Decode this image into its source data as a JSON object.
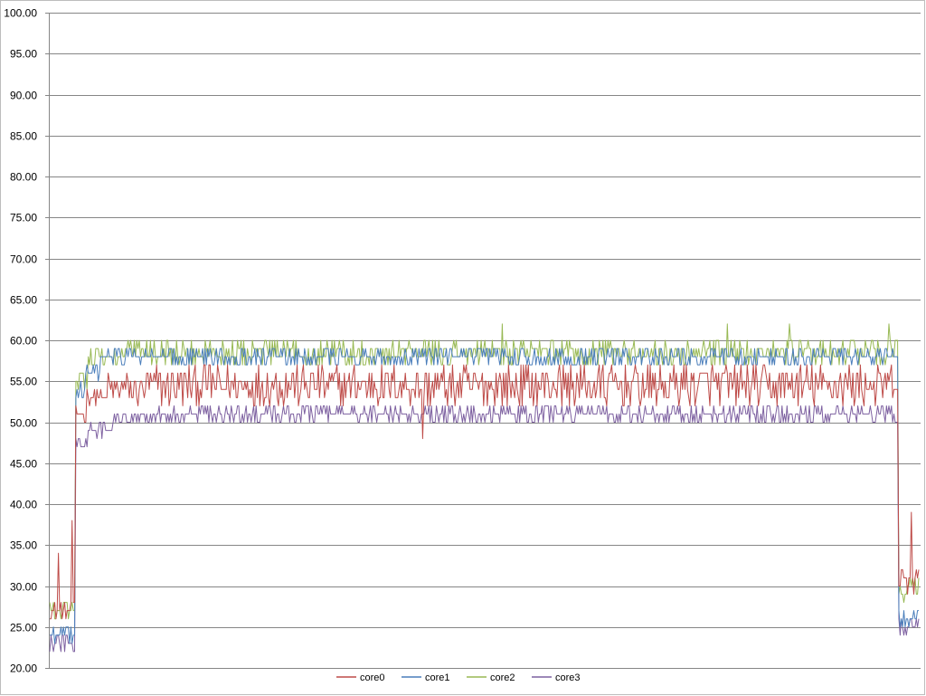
{
  "chart_data": {
    "type": "line",
    "title": "",
    "xlabel": "",
    "ylabel": "",
    "ylim": [
      20,
      100
    ],
    "y_ticks": [
      "20.00",
      "25.00",
      "30.00",
      "35.00",
      "40.00",
      "45.00",
      "50.00",
      "55.00",
      "60.00",
      "65.00",
      "70.00",
      "75.00",
      "80.00",
      "85.00",
      "90.00",
      "95.00",
      "100.00"
    ],
    "grid": "horizontal",
    "legend_position": "bottom",
    "x_count": 700,
    "series": [
      {
        "name": "core0",
        "color": "#BE4B48",
        "segments": [
          {
            "x": [
              0,
              19
            ],
            "min": 26,
            "max": 28,
            "spikes": [
              [
                7,
                34
              ],
              [
                18,
                38
              ]
            ]
          },
          {
            "x": [
              21,
              29
            ],
            "min": 50,
            "max": 52
          },
          {
            "x": [
              30,
              45
            ],
            "min": 52,
            "max": 54
          },
          {
            "x": [
              46,
              75
            ],
            "min": 52,
            "max": 56
          },
          {
            "x": [
              76,
              680
            ],
            "min": 52,
            "max": 57,
            "spikes": [
              [
                300,
                48
              ]
            ]
          },
          {
            "x": [
              683,
              699
            ],
            "min": 29,
            "max": 32,
            "spikes": [
              [
                693,
                39
              ]
            ]
          }
        ]
      },
      {
        "name": "core1",
        "color": "#4A7EBB",
        "segments": [
          {
            "x": [
              0,
              19
            ],
            "min": 23,
            "max": 25
          },
          {
            "x": [
              21,
              28
            ],
            "min": 53,
            "max": 55
          },
          {
            "x": [
              29,
              40
            ],
            "min": 55,
            "max": 57
          },
          {
            "x": [
              41,
              70
            ],
            "min": 57,
            "max": 59
          },
          {
            "x": [
              71,
              680
            ],
            "min": 57,
            "max": 59
          },
          {
            "x": [
              683,
              699
            ],
            "min": 25,
            "max": 27
          }
        ]
      },
      {
        "name": "core2",
        "color": "#98B954",
        "segments": [
          {
            "x": [
              0,
              19
            ],
            "min": 26,
            "max": 28
          },
          {
            "x": [
              21,
              30
            ],
            "min": 54,
            "max": 57
          },
          {
            "x": [
              31,
              60
            ],
            "min": 57,
            "max": 59
          },
          {
            "x": [
              61,
              680
            ],
            "min": 57,
            "max": 60,
            "spikes": [
              [
                364,
                62
              ],
              [
                545,
                62
              ],
              [
                595,
                62
              ],
              [
                675,
                62
              ]
            ]
          },
          {
            "x": [
              683,
              699
            ],
            "min": 28,
            "max": 31
          }
        ]
      },
      {
        "name": "core3",
        "color": "#7D60A0",
        "segments": [
          {
            "x": [
              0,
              19
            ],
            "min": 22,
            "max": 24
          },
          {
            "x": [
              21,
              30
            ],
            "min": 47,
            "max": 48
          },
          {
            "x": [
              31,
              50
            ],
            "min": 48,
            "max": 50
          },
          {
            "x": [
              51,
              75
            ],
            "min": 50,
            "max": 51
          },
          {
            "x": [
              76,
              680
            ],
            "min": 50,
            "max": 52
          },
          {
            "x": [
              683,
              699
            ],
            "min": 24,
            "max": 26
          }
        ]
      }
    ]
  }
}
